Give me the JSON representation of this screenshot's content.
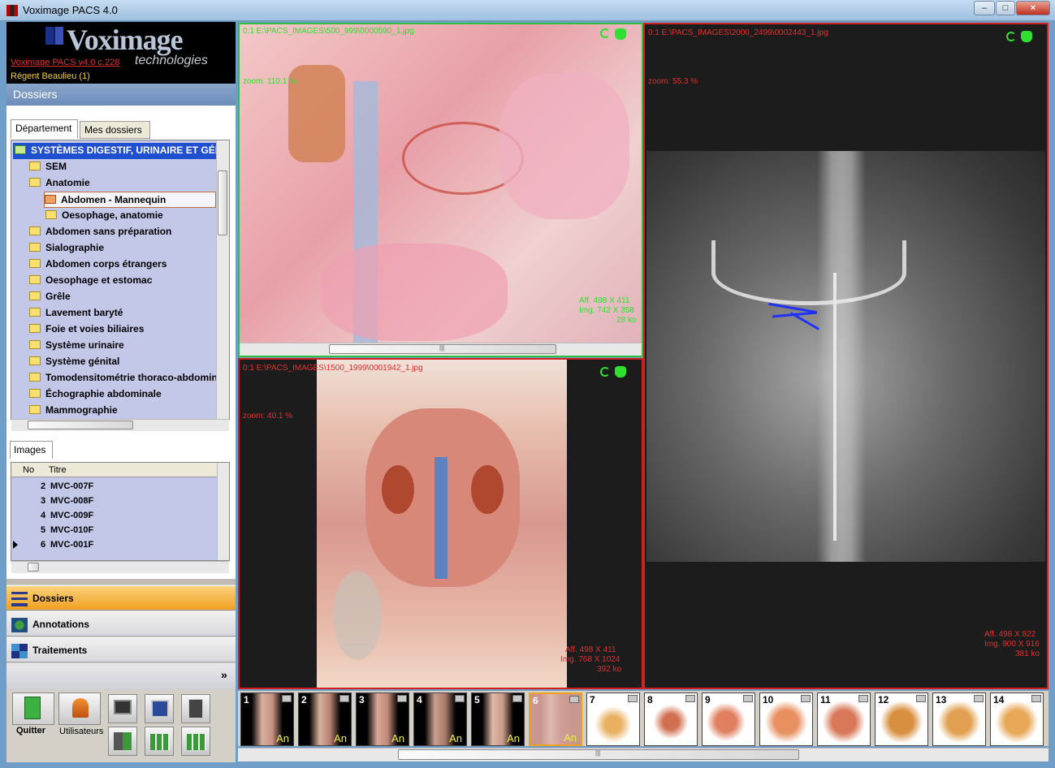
{
  "window": {
    "title": "Voximage PACS 4.0",
    "min": "–",
    "max": "□",
    "close": "×"
  },
  "brand": {
    "name": "Voximage",
    "sub": "technologies",
    "version": "Voximage PACS v4.0  c.228",
    "user": "Régent Beaulieu (1)"
  },
  "dossiers": {
    "header": "Dossiers",
    "tabs": [
      "Département",
      "Mes dossiers"
    ],
    "tree": [
      {
        "label": "SYSTÈMES DIGESTIF, URINAIRE ET GÉNITAL"
      },
      {
        "label": "SEM"
      },
      {
        "label": "Anatomie"
      },
      {
        "label": "Abdomen - Mannequin"
      },
      {
        "label": "Oesophage, anatomie"
      },
      {
        "label": "Abdomen sans préparation"
      },
      {
        "label": "Sialographie"
      },
      {
        "label": "Abdomen corps étrangers"
      },
      {
        "label": "Oesophage et estomac"
      },
      {
        "label": "Grêle"
      },
      {
        "label": "Lavement baryté"
      },
      {
        "label": "Foie et voies biliaires"
      },
      {
        "label": "Système urinaire"
      },
      {
        "label": "Système génital"
      },
      {
        "label": "Tomodensitométrie thoraco-abdominale"
      },
      {
        "label": "Échographie abdominale"
      },
      {
        "label": "Mammographie"
      }
    ]
  },
  "images": {
    "tab": "Images",
    "columns": [
      "No",
      "Titre"
    ],
    "rows": [
      {
        "no": "2",
        "title": "MVC-007F"
      },
      {
        "no": "3",
        "title": "MVC-008F"
      },
      {
        "no": "4",
        "title": "MVC-009F"
      },
      {
        "no": "5",
        "title": "MVC-010F"
      },
      {
        "no": "6",
        "title": "MVC-001F"
      }
    ]
  },
  "nav": {
    "dossiers": "Dossiers",
    "annotations": "Annotations",
    "traitements": "Traitements",
    "more": "»"
  },
  "tools": {
    "quitter": "Quitter",
    "utilisateurs": "Utilisateurs"
  },
  "viewers": {
    "v1": {
      "path": "0:1 E:\\PACS_IMAGES\\500_999\\0000590_1.jpg",
      "zoom": "zoom: 110.1 %",
      "aff": "Aff. 498 X 411",
      "img": "Img. 742 X 358",
      "size": "28 ko"
    },
    "v2": {
      "path": "0:1 E:\\PACS_IMAGES\\1500_1999\\0001942_1.jpg",
      "zoom": "zoom: 40.1 %",
      "aff": "Aff. 498 X 411",
      "img": "Img. 768 X 1024",
      "size": "392 ko"
    },
    "v3": {
      "path": "0:1 E:\\PACS_IMAGES\\2000_2499\\0002443_1.jpg",
      "zoom": "zoom: 55.3 %",
      "aff": "Aff. 498 X 822",
      "img": "Img. 900 X 916",
      "size": "381 ko"
    }
  },
  "thumbnails": [
    {
      "n": "1",
      "an": "An"
    },
    {
      "n": "2",
      "an": "An"
    },
    {
      "n": "3",
      "an": "An"
    },
    {
      "n": "4",
      "an": "An"
    },
    {
      "n": "5",
      "an": "An"
    },
    {
      "n": "6",
      "an": "An"
    },
    {
      "n": "7",
      "an": ""
    },
    {
      "n": "8",
      "an": ""
    },
    {
      "n": "9",
      "an": ""
    },
    {
      "n": "10",
      "an": ""
    },
    {
      "n": "11",
      "an": ""
    },
    {
      "n": "12",
      "an": ""
    },
    {
      "n": "13",
      "an": ""
    },
    {
      "n": "14",
      "an": ""
    }
  ],
  "scroll": {
    "grip": "|||"
  },
  "colors": {
    "selected_border": "#30c040",
    "viewer_border": "#d02020",
    "accent": "#f0a020"
  }
}
